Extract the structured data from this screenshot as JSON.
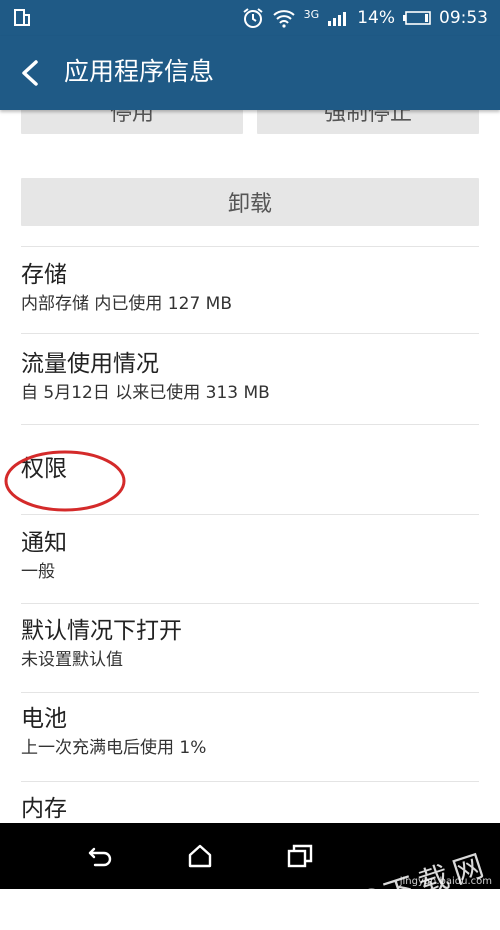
{
  "status_bar": {
    "signal_type": "3G",
    "battery": "14%",
    "time": "09:53"
  },
  "app_bar": {
    "title": "应用程序信息"
  },
  "buttons": {
    "disable": "停用",
    "force_stop": "强制停止",
    "uninstall": "卸载"
  },
  "items": [
    {
      "title": "存储",
      "subtitle": "内部存储 内已使用 127 MB"
    },
    {
      "title": "流量使用情况",
      "subtitle": "自 5月12日 以来已使用 313 MB"
    },
    {
      "title": "权限",
      "subtitle": ""
    },
    {
      "title": "通知",
      "subtitle": "一般"
    },
    {
      "title": "默认情况下打开",
      "subtitle": "未设置默认值"
    },
    {
      "title": "电池",
      "subtitle": "上一次充满电后使用 1%"
    },
    {
      "title": "内存",
      "subtitle": ""
    }
  ],
  "watermark": {
    "text": "PC下载网",
    "sub": "jingyan.baidu.com"
  },
  "colors": {
    "primary": "#1f5a86",
    "button_bg": "#e6e6e6",
    "highlight_circle": "#d42a2a"
  }
}
